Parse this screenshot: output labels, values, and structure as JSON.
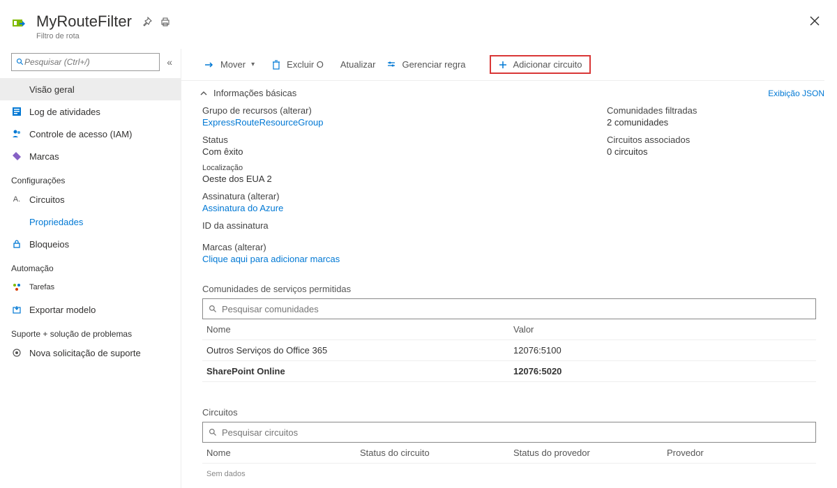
{
  "header": {
    "title": "MyRouteFilter",
    "subtitle": "Filtro de rota"
  },
  "sidebar": {
    "search_placeholder": "Pesquisar (Ctrl+/)",
    "items": {
      "overview": "Visão geral",
      "activity": "Log de atividades",
      "iam": "Controle de acesso (IAM)",
      "tags": "Marcas"
    },
    "sections": {
      "config": "Configurações",
      "automation": "Automação",
      "support": "Suporte +   solução de problemas"
    },
    "config_items": {
      "circuits": "Circuitos",
      "properties": "Propriedades",
      "locks": "Bloqueios"
    },
    "automation_items": {
      "tasks": "Tarefas",
      "export": "Exportar modelo"
    },
    "support_items": {
      "new_request": "Nova solicitação de suporte"
    }
  },
  "toolbar": {
    "move": "Mover",
    "delete": "Excluir O",
    "refresh": "Atualizar",
    "manage_rule": "Gerenciar regra",
    "add_circuit": "Adicionar circuito"
  },
  "essentials": {
    "header": "Informações básicas",
    "json_view": "Exibição JSON",
    "left": {
      "rg_label": "Grupo de recursos (alterar)",
      "rg_value": "ExpressRouteResourceGroup",
      "status_label": "Status",
      "status_value": "Com êxito",
      "location_label": "Localização",
      "location_value": "Oeste dos EUA 2",
      "sub_label": "Assinatura (alterar)",
      "sub_value": "Assinatura do Azure",
      "subid_label": "ID da assinatura"
    },
    "right": {
      "filtered_label": "Comunidades filtradas",
      "filtered_value": "2 comunidades",
      "assoc_label": "Circuitos associados",
      "assoc_value": "0 circuitos"
    }
  },
  "tags": {
    "label": "Marcas (alterar)",
    "value": "Clique aqui para adicionar marcas"
  },
  "communities": {
    "title": "Comunidades de serviços permitidas",
    "search_placeholder": "Pesquisar comunidades",
    "col_name": "Nome",
    "col_value": "Valor",
    "rows": [
      {
        "name": "Outros Serviços do Office 365",
        "value": "12076:5100"
      },
      {
        "name": "SharePoint Online",
        "value": "12076:5020"
      }
    ]
  },
  "circuits": {
    "title": "Circuitos",
    "search_placeholder": "Pesquisar circuitos",
    "col_name": "Nome",
    "col_circuit_status": "Status do circuito",
    "col_provider_status": "Status do provedor",
    "col_provider": "Provedor",
    "no_data": "Sem dados"
  }
}
